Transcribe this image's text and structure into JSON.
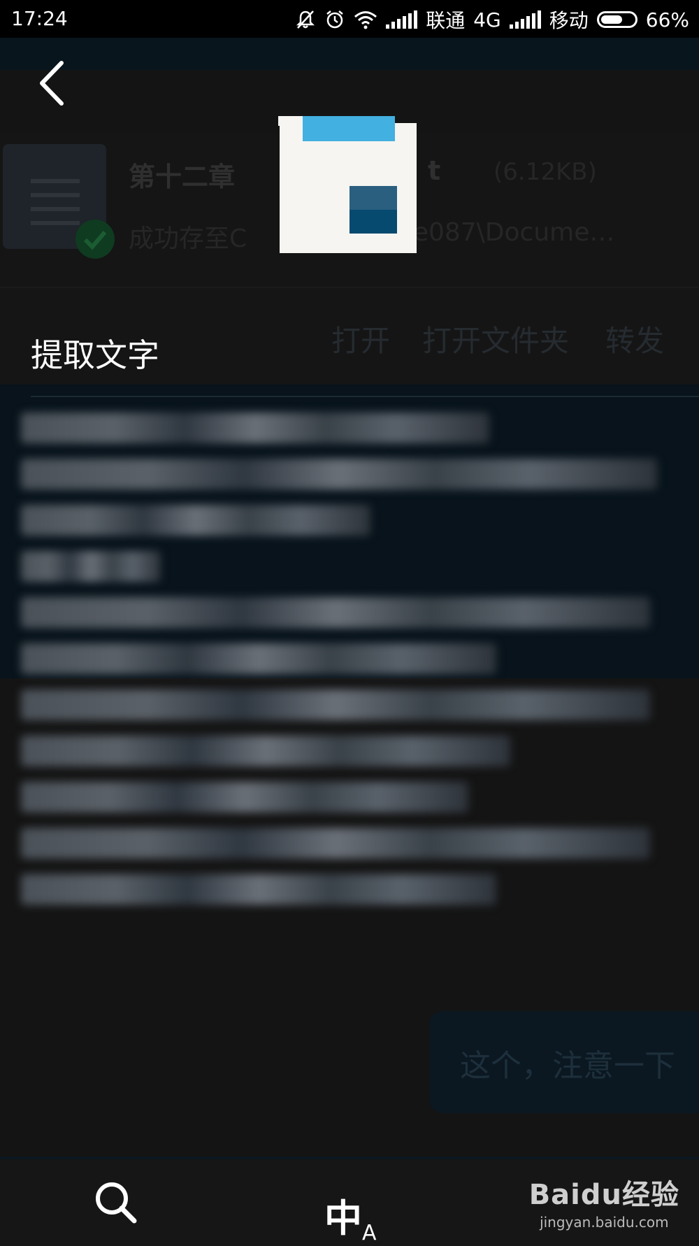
{
  "status_bar": {
    "time": "17:24",
    "carrier_1": "联通",
    "network_1": "4G",
    "carrier_2": "移动",
    "battery": "66%",
    "battery_level": 0.66
  },
  "background_chat": {
    "file_name_left": "第十二章",
    "file_name_right": "t",
    "file_size": "(6.12KB)",
    "save_status_left": "成功存至C",
    "save_status_right": "ue087\\Docume…",
    "action_open": "打开",
    "action_open_folder": "打开文件夹",
    "action_forward": "转发",
    "bubble_text": "这个，注意一下"
  },
  "extract_panel": {
    "title": "提取文字"
  },
  "bottom_bar": {
    "translate_main": "中",
    "translate_sub": "A"
  },
  "watermark": {
    "logo": "Baidu经验",
    "url": "jingyan.baidu.com"
  },
  "colors": {
    "background": "#141414",
    "overlay_dark": "#08131b",
    "accent_blue": "#42b0e0",
    "accent_dark_blue": "#0a5d87"
  }
}
